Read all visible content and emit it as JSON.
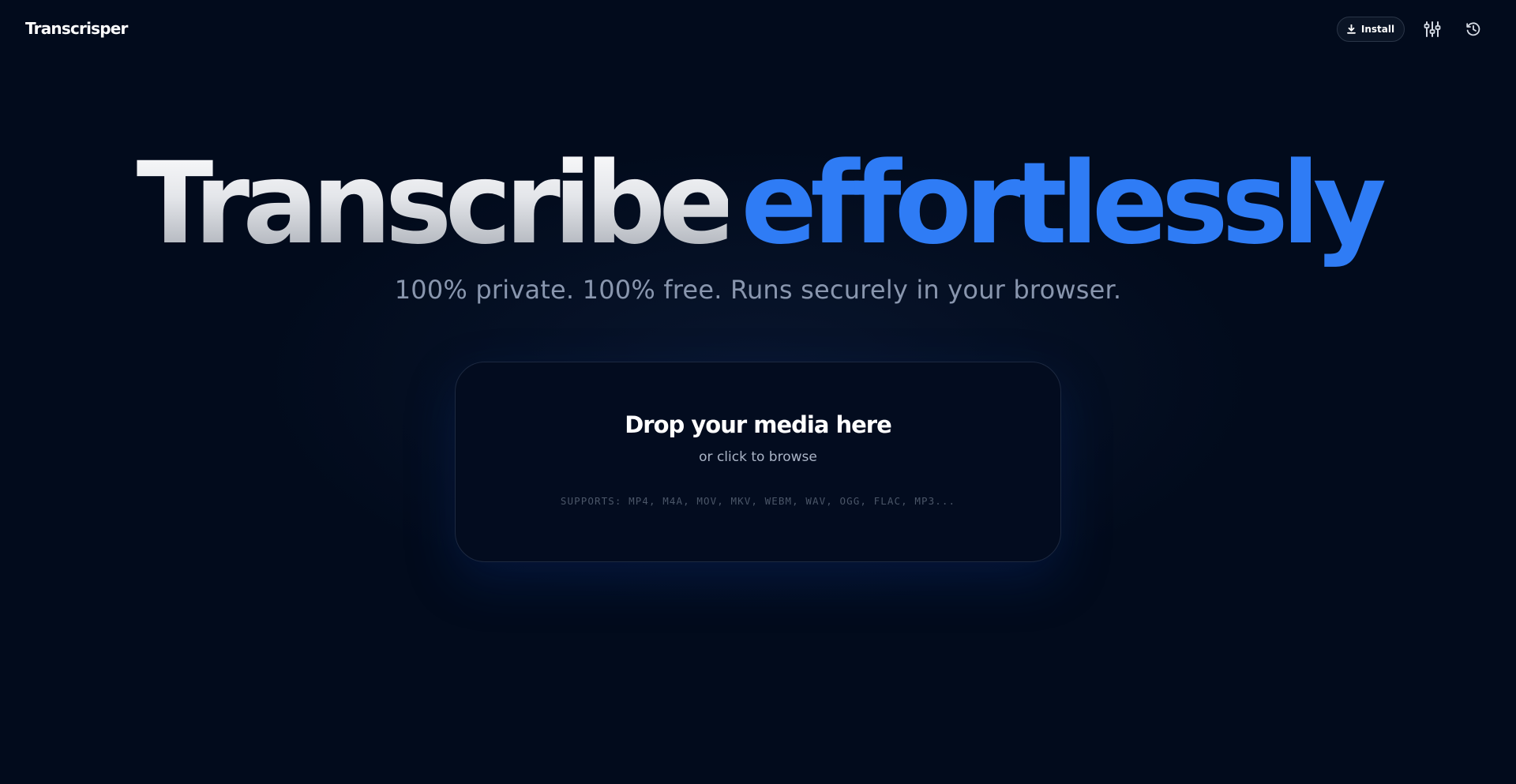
{
  "header": {
    "brand": "Transcrisper",
    "install_label": "Install",
    "icons": [
      "download-icon",
      "equalizer-icon",
      "history-icon"
    ]
  },
  "hero": {
    "title_part1": "Transcribe",
    "title_part2": "effortlessly",
    "subtitle": "100% private. 100% free. Runs securely in your browser."
  },
  "dropzone": {
    "title": "Drop your media here",
    "subtitle": "or click to browse",
    "supports": "SUPPORTS: MP4, M4A, MOV, MKV, WEBM, WAV, OGG, FLAC, MP3..."
  },
  "colors": {
    "background": "#020b1c",
    "accent": "#2f7cf5",
    "subtitle": "#8996ae"
  }
}
